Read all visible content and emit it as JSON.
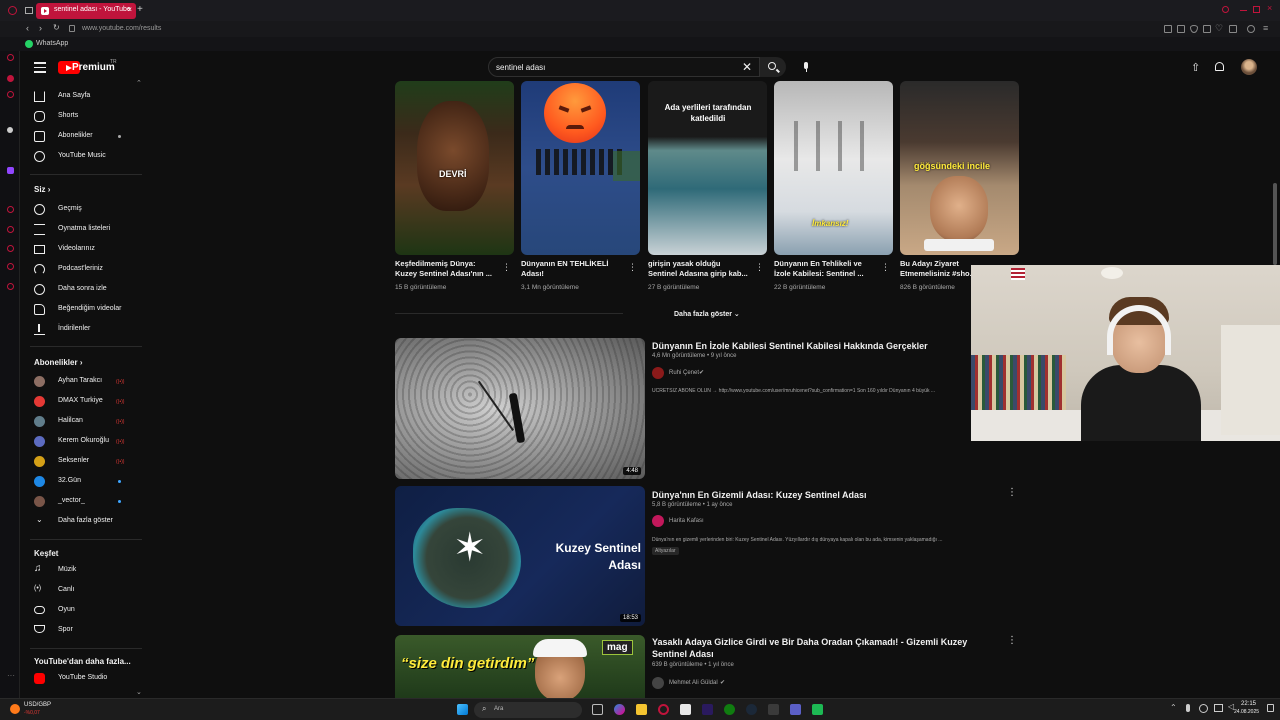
{
  "browser": {
    "tab_title": "sentinel adası - YouTube",
    "url": "www.youtube.com/results",
    "bookmark": "WhatsApp"
  },
  "header": {
    "logo_text": "Premium",
    "logo_region": "TR",
    "search_query": "sentinel adası"
  },
  "sidebar": {
    "main": [
      {
        "label": "Ana Sayfa",
        "icon": "home-icon"
      },
      {
        "label": "Shorts",
        "icon": "shorts-icon"
      },
      {
        "label": "Abonelikler",
        "icon": "subscriptions-icon"
      },
      {
        "label": "YouTube Music",
        "icon": "music-icon"
      }
    ],
    "siz_heading": "Siz",
    "siz": [
      {
        "label": "Geçmiş",
        "icon": "history-icon"
      },
      {
        "label": "Oynatma listeleri",
        "icon": "playlist-icon"
      },
      {
        "label": "Videolarınız",
        "icon": "your-videos-icon"
      },
      {
        "label": "Podcast'leriniz",
        "icon": "podcast-icon"
      },
      {
        "label": "Daha sonra izle",
        "icon": "watch-later-icon"
      },
      {
        "label": "Beğendiğim videolar",
        "icon": "like-icon"
      },
      {
        "label": "İndirilenler",
        "icon": "download-icon"
      }
    ],
    "subs_heading": "Abonelikler",
    "subs": [
      {
        "label": "Ayhan Tarakcı",
        "color": "#8d6e63",
        "status": "live"
      },
      {
        "label": "DMAX Turkiye",
        "color": "#e53935",
        "status": "live"
      },
      {
        "label": "Halilcan",
        "color": "#607d8b",
        "status": "live"
      },
      {
        "label": "Kerem Okuroğlu",
        "color": "#5c6bc0",
        "status": "live"
      },
      {
        "label": "Seksenler",
        "color": "#d4a017",
        "status": "live"
      },
      {
        "label": "32.Gün",
        "color": "#1e88e5",
        "status": "new"
      },
      {
        "label": "_vector_",
        "color": "#795548",
        "status": "new"
      }
    ],
    "show_more": "Daha fazla göster",
    "explore_heading": "Keşfet",
    "explore": [
      {
        "label": "Müzik",
        "icon": "music-note-icon"
      },
      {
        "label": "Canlı",
        "icon": "live-icon"
      },
      {
        "label": "Oyun",
        "icon": "gaming-icon"
      },
      {
        "label": "Spor",
        "icon": "trophy-icon"
      }
    ],
    "more_heading": "YouTube'dan daha fazla...",
    "more": [
      {
        "label": "YouTube Studio",
        "icon": "studio-icon"
      }
    ]
  },
  "shorts": [
    {
      "title_line1": "Keşfedilmemiş Dünya:",
      "title_line2": "Kuzey Sentinel Adası'nın ...",
      "views": "15 B görüntüleme",
      "overlay": "DEVRİ"
    },
    {
      "title_line1": "Dünyanın EN TEHLİKELİ",
      "title_line2": "Adası!",
      "views": "3,1 Mn görüntüleme",
      "overlay": ""
    },
    {
      "title_line1": "girişin yasak olduğu",
      "title_line2": "Sentinel Adasına girip kab...",
      "views": "27 B görüntüleme",
      "overlay": "Ada yerlileri tarafından katledildi"
    },
    {
      "title_line1": "Dünyanın En Tehlikeli ve",
      "title_line2": "İzole Kabilesi: Sentinel ...",
      "views": "22 B görüntüleme",
      "overlay": "İmkansız!"
    },
    {
      "title_line1": "Bu Adayı Ziyaret",
      "title_line2": "Etmemelisiniz #sho...",
      "views": "826 B görüntüleme",
      "overlay": "göğsündeki incile"
    }
  ],
  "show_more_shorts": "Daha fazla göster",
  "videos": [
    {
      "title": "Dünyanın En İzole Kabilesi Sentinel Kabilesi Hakkında Gerçekler",
      "meta": "4,6 Mn görüntüleme • 9 yıl önce",
      "channel": "Ruhi Çenet",
      "desc": "ÜCRETSİZ ABONE OLUN → http://www.youtube.com/user/mruhicenet?sub_confirmation=1 Son 160 yıldır Dünyanın 4 büyük ...",
      "duration": "4:48",
      "chip": ""
    },
    {
      "title": "Dünya'nın En Gizemli Adası: Kuzey Sentinel Adası",
      "meta": "5,8 B görüntüleme • 1 ay önce",
      "channel": "Harita Kafası",
      "desc": "Dünya'nın en gizemli yerlerinden biri: Kuzey Sentinel Adası. Yüzyıllardır dış dünyaya kapalı olan bu ada, kimsenin yaklaşamadığı ...",
      "duration": "18:53",
      "chip": "Altyazılar",
      "thumb_text_1": "Kuzey Sentinel",
      "thumb_text_2": "Adası"
    },
    {
      "title": "Yasaklı Adaya Gizlice Girdi ve Bir Daha Oradan Çıkamadı! - Gizemli Kuzey Sentinel Adası",
      "meta": "639 B görüntüleme • 1 yıl önce",
      "channel": "Mehmet Ali Güldal",
      "desc": "",
      "duration": "",
      "chip": "",
      "thumb_text_1": "“size din getirdim”",
      "thumb_badge": "mag"
    }
  ],
  "taskbar": {
    "ticker_label": "USD/GBP",
    "ticker_value": "-%0,07",
    "search_placeholder": "Ara",
    "time": "22:15",
    "date": "24.08.2025"
  }
}
